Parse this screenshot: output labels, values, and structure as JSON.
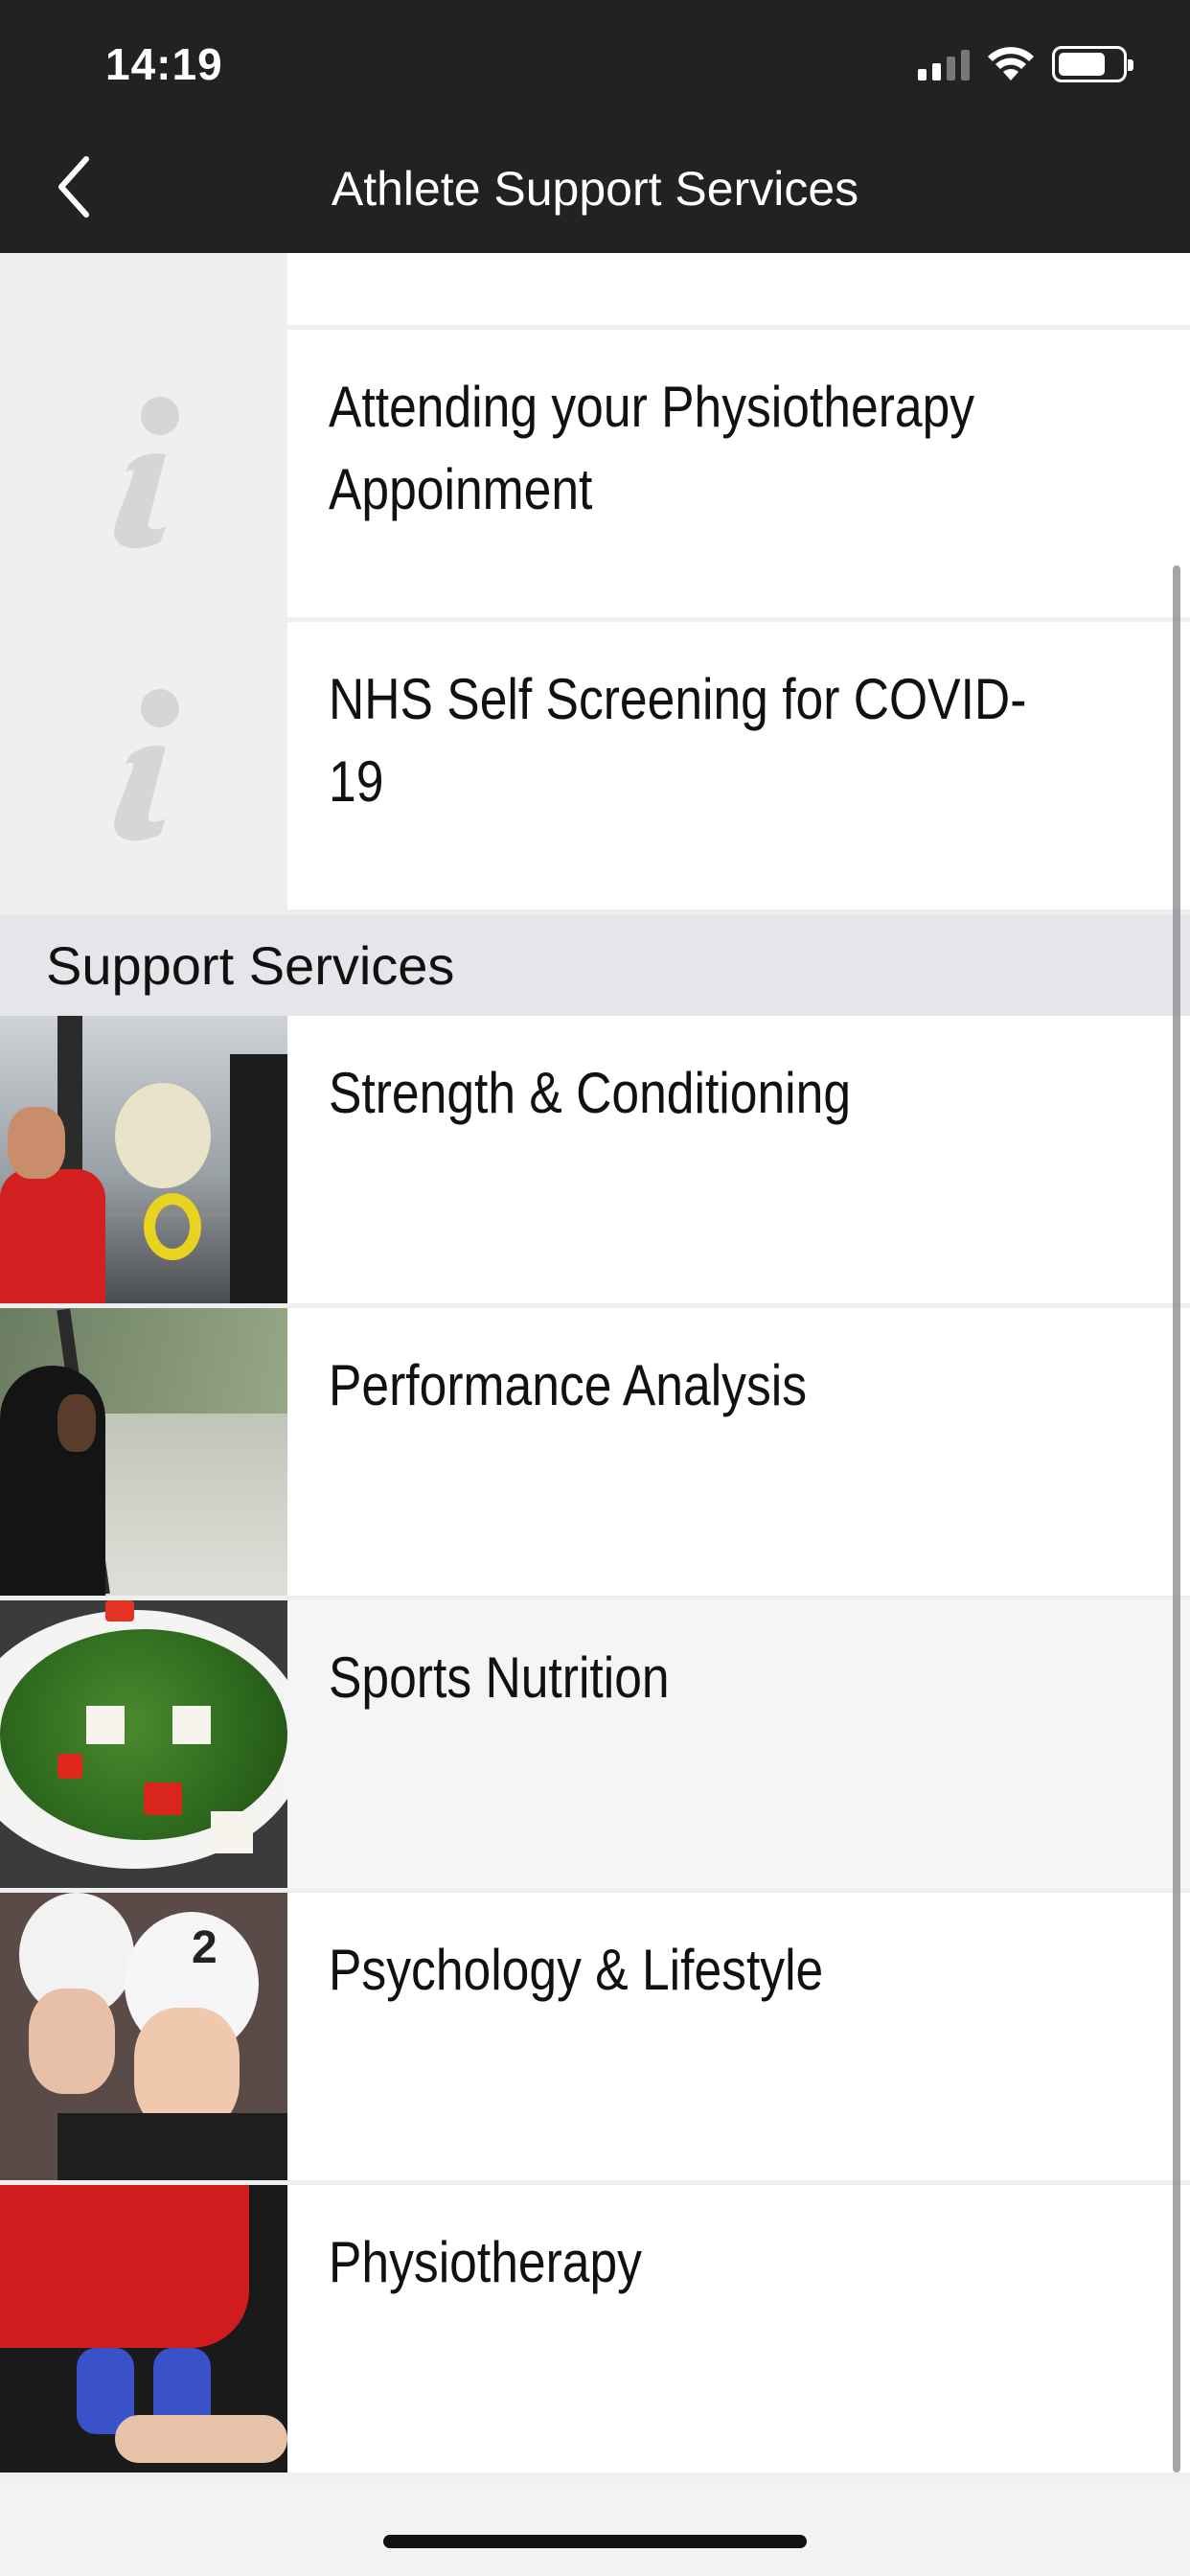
{
  "status_bar": {
    "time": "14:19"
  },
  "nav": {
    "title": "Athlete Support Services",
    "back_icon": "chevron-left-icon"
  },
  "info_items": [
    {
      "label": "Attending your Physiotherapy Appoinment",
      "icon": "info-icon"
    },
    {
      "label": "NHS Self Screening for COVID-19",
      "icon": "info-icon"
    }
  ],
  "section": {
    "title": "Support Services"
  },
  "services": [
    {
      "label": "Strength & Conditioning",
      "image": "weightlifting-photo"
    },
    {
      "label": "Performance Analysis",
      "image": "analyst-photo"
    },
    {
      "label": "Sports Nutrition",
      "image": "salad-photo"
    },
    {
      "label": "Psychology & Lifestyle",
      "image": "water-polo-photo"
    },
    {
      "label": "Physiotherapy",
      "image": "physio-photo"
    }
  ],
  "colors": {
    "header_bg": "#222222",
    "section_bg": "#e5e5ea",
    "info_icon": "#d0d0d0"
  }
}
